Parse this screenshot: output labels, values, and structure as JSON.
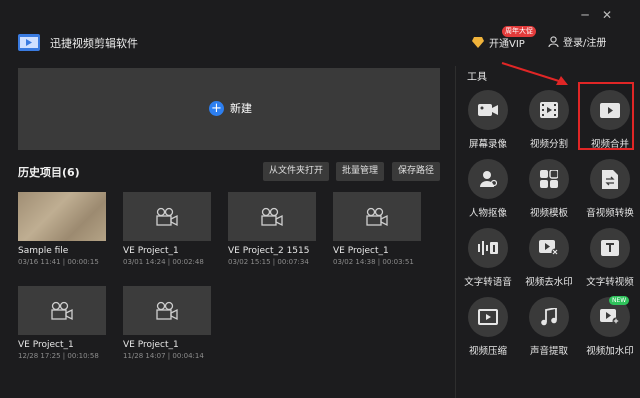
{
  "app": {
    "title": "迅捷视频剪辑软件"
  },
  "header": {
    "vip_label": "开通VIP",
    "vip_badge": "周年大促",
    "login_label": "登录/注册",
    "minimize": "─",
    "close": "✕"
  },
  "main": {
    "new_label": "新建",
    "history_title": "历史项目(6)",
    "buttons": {
      "open_folder": "从文件夹打开",
      "batch": "批量管理",
      "save_path": "保存路径"
    },
    "projects": [
      {
        "name": "Sample file",
        "meta": "03/16 11:41 | 00:00:15"
      },
      {
        "name": "VE Project_1",
        "meta": "03/01 14:24 | 00:02:48"
      },
      {
        "name": "VE Project_2 1515",
        "meta": "03/02 15:15 | 00:07:34"
      },
      {
        "name": "VE Project_1",
        "meta": "03/02 14:38 | 00:03:51"
      },
      {
        "name": "VE Project_1",
        "meta": "12/28 17:25 | 00:10:58"
      },
      {
        "name": "VE Project_1",
        "meta": "11/28 14:07 | 00:04:14"
      }
    ]
  },
  "tools": {
    "title": "工具",
    "items": [
      {
        "label": "屏幕录像"
      },
      {
        "label": "视频分割"
      },
      {
        "label": "视频合并"
      },
      {
        "label": "人物抠像"
      },
      {
        "label": "视频模板"
      },
      {
        "label": "音视频转换"
      },
      {
        "label": "文字转语音"
      },
      {
        "label": "视频去水印"
      },
      {
        "label": "文字转视频"
      },
      {
        "label": "视频压缩"
      },
      {
        "label": "声音提取"
      },
      {
        "label": "视频加水印"
      }
    ],
    "new_tag": "NEW"
  },
  "colors": {
    "accent": "#2d7ff0",
    "highlight": "#e02626",
    "badge": "#e23b3b",
    "new": "#2fc25b"
  }
}
